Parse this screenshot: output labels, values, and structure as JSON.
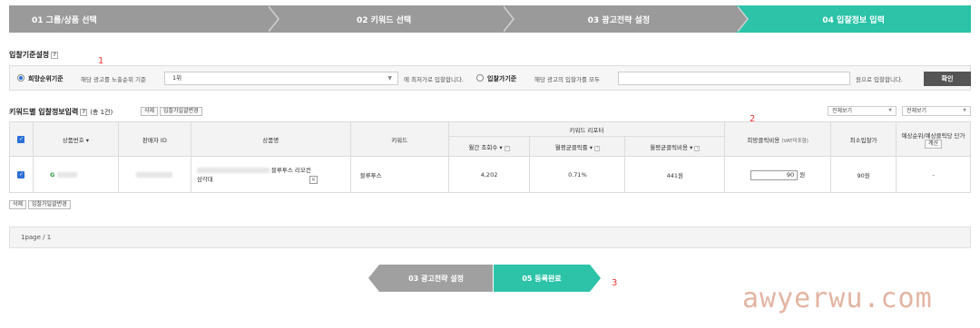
{
  "steps": [
    {
      "label": "01 그룹/상품 선택",
      "active": false
    },
    {
      "label": "02 키워드 선택",
      "active": false
    },
    {
      "label": "03 광고전략 설정",
      "active": false
    },
    {
      "label": "04 입찰정보 입력",
      "active": true
    }
  ],
  "criteria": {
    "title": "입찰기준설정",
    "marker": "1",
    "option1_label": "희망순위기준",
    "option1_desc": "해당 광고를 노출순위 기준",
    "option1_value": "1위",
    "option1_suffix": "에 최저가로 입찰합니다.",
    "option2_label": "입찰가기준",
    "option2_desc": "해당 광고의 입찰가를 모두",
    "option2_value": "",
    "option2_suffix": "원으로 입찰합니다.",
    "confirm_label": "확인"
  },
  "keyword_section": {
    "title": "키워드별 입찰정보입력",
    "count_text": "(총 1건)",
    "delete_label": "삭제",
    "bulk_change_label": "입찰가일괄변경",
    "filter1": "전체보기",
    "filter2": "전체보기",
    "marker": "2"
  },
  "table": {
    "headers": {
      "product_no": "상품번호 ▾",
      "seller_id": "판매자 ID",
      "product_name": "상품명",
      "keyword": "키워드",
      "keyword_report": "키워드 리포터",
      "monthly_search": "월간 조회수 ▾",
      "avg_ctr": "월평균클릭률 ▾",
      "avg_cpc": "월평균클릭비용 ▾",
      "desired_cpc": "희망클릭비용",
      "desired_cpc_note": "(VAT미포함)",
      "min_bid": "최소입찰가",
      "expected_rank": "예상순위/예상클릭당 단가",
      "calc_label": "계산"
    },
    "row": {
      "product_no_prefix": "G",
      "product_name_line1": "블루투스 리모컨",
      "product_name_line2": "삼각대",
      "remove_icon": "×",
      "keyword": "블루투스",
      "monthly_search": "4,202",
      "avg_ctr": "0.71%",
      "avg_cpc": "441원",
      "bid_value": "90",
      "bid_unit": "원",
      "min_bid": "90원",
      "expected": "-"
    }
  },
  "bottom_actions": {
    "delete_label": "삭제",
    "bulk_change_label": "입찰가일괄변경"
  },
  "pagebar": {
    "text": "1page / 1"
  },
  "nav": {
    "prev_label": "03 광고전략 설정",
    "next_label": "05 등록완료",
    "marker": "3"
  },
  "watermark": "awyerwu.com",
  "colors": {
    "accent": "#2cc3a8",
    "step_inactive": "#9a9a9a",
    "checkbox": "#2a6fd6",
    "marker_red": "#ee3333"
  }
}
